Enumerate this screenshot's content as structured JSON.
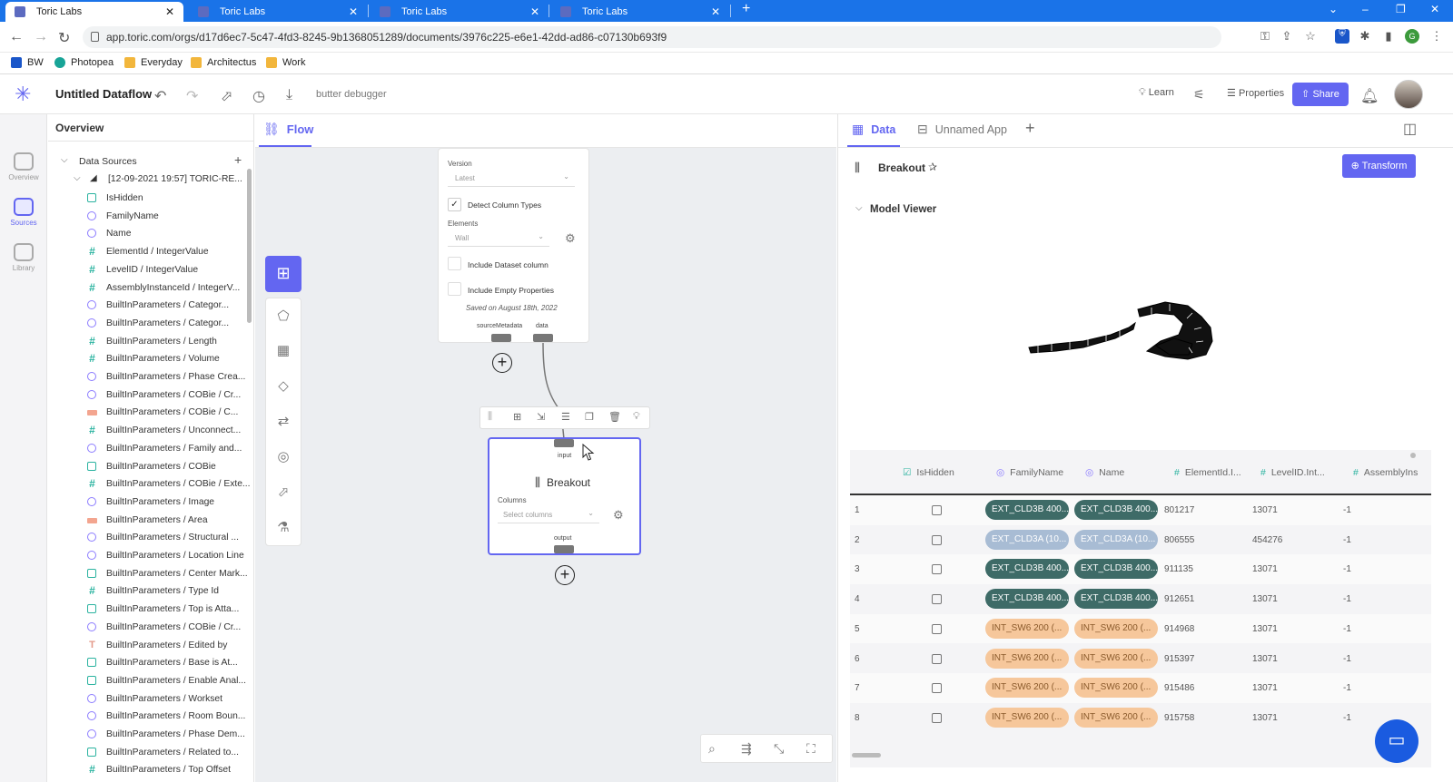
{
  "browser": {
    "tabs": [
      {
        "title": "Toric Labs"
      },
      {
        "title": "Toric Labs"
      },
      {
        "title": "Toric Labs"
      },
      {
        "title": "Toric Labs"
      }
    ],
    "url": "app.toric.com/orgs/d17d6ec7-5c47-4fd3-8245-9b1368051289/documents/3976c225-e6e1-42dd-ad86-c07130b693f9",
    "bookmarks": [
      "BW",
      "Photopea",
      "Everyday",
      "Architectus",
      "Work"
    ]
  },
  "app": {
    "title": "Untitled Dataflow",
    "debugger_label": "butter debugger",
    "learn_label": "Learn",
    "properties_label": "Properties",
    "share_label": "Share"
  },
  "rail": [
    {
      "label": "Overview",
      "icon": "overview-icon"
    },
    {
      "label": "Sources",
      "icon": "database-icon"
    },
    {
      "label": "Library",
      "icon": "library-icon"
    }
  ],
  "sidebar": {
    "title": "Overview",
    "section": "Data Sources",
    "source": "[12-09-2021 19:57] TORIC-RE...",
    "fields": [
      {
        "type": "bool",
        "label": "IsHidden"
      },
      {
        "type": "str",
        "label": "FamilyName"
      },
      {
        "type": "str",
        "label": "Name"
      },
      {
        "type": "num",
        "label": "ElementId / IntegerValue"
      },
      {
        "type": "num",
        "label": "LevelID / IntegerValue"
      },
      {
        "type": "num",
        "label": "AssemblyInstanceId / IntegerV..."
      },
      {
        "type": "str",
        "label": "BuiltInParameters / Categor..."
      },
      {
        "type": "str",
        "label": "BuiltInParameters / Categor..."
      },
      {
        "type": "num",
        "label": "BuiltInParameters / Length"
      },
      {
        "type": "num",
        "label": "BuiltInParameters / Volume"
      },
      {
        "type": "str",
        "label": "BuiltInParameters / Phase Crea..."
      },
      {
        "type": "str",
        "label": "BuiltInParameters / COBie / Cr..."
      },
      {
        "type": "obj",
        "label": "BuiltInParameters / COBie / C..."
      },
      {
        "type": "num",
        "label": "BuiltInParameters / Unconnect..."
      },
      {
        "type": "str",
        "label": "BuiltInParameters / Family and..."
      },
      {
        "type": "bool",
        "label": "BuiltInParameters / COBie"
      },
      {
        "type": "num",
        "label": "BuiltInParameters / COBie / Exte..."
      },
      {
        "type": "str",
        "label": "BuiltInParameters / Image"
      },
      {
        "type": "obj",
        "label": "BuiltInParameters / Area"
      },
      {
        "type": "str",
        "label": "BuiltInParameters / Structural ..."
      },
      {
        "type": "str",
        "label": "BuiltInParameters / Location Line"
      },
      {
        "type": "bool",
        "label": "BuiltInParameters / Center Mark..."
      },
      {
        "type": "num",
        "label": "BuiltInParameters / Type Id"
      },
      {
        "type": "bool",
        "label": "BuiltInParameters / Top is Atta..."
      },
      {
        "type": "str",
        "label": "BuiltInParameters / COBie / Cr..."
      },
      {
        "type": "txt",
        "label": "BuiltInParameters / Edited by"
      },
      {
        "type": "bool",
        "label": "BuiltInParameters / Base is At..."
      },
      {
        "type": "bool",
        "label": "BuiltInParameters / Enable Anal..."
      },
      {
        "type": "str",
        "label": "BuiltInParameters / Workset"
      },
      {
        "type": "str",
        "label": "BuiltInParameters / Room Boun..."
      },
      {
        "type": "str",
        "label": "BuiltInParameters / Phase Dem..."
      },
      {
        "type": "bool",
        "label": "BuiltInParameters / Related to..."
      },
      {
        "type": "num",
        "label": "BuiltInParameters / Top Offset"
      }
    ]
  },
  "flow": {
    "tab_label": "Flow",
    "source_node": {
      "version_label": "Version",
      "version_value": "Latest",
      "detect_label": "Detect Column Types",
      "elements_label": "Elements",
      "elements_value": "Wall",
      "include_dataset": "Include Dataset column",
      "include_empty": "Include Empty Properties",
      "saved": "Saved on August 18th, 2022",
      "port_meta": "sourceMetadata",
      "port_data": "data"
    },
    "breakout_node": {
      "input_label": "input",
      "title": "Breakout",
      "columns_label": "Columns",
      "columns_placeholder": "Select columns",
      "output_label": "output"
    }
  },
  "data_panel": {
    "tabs": [
      {
        "label": "Data"
      },
      {
        "label": "Unnamed App"
      }
    ],
    "node_title": "Breakout",
    "transform_label": "Transform",
    "viewer_label": "Model Viewer",
    "columns": [
      {
        "icon": "checkbox-icon",
        "label": "IsHidden"
      },
      {
        "icon": "string-icon",
        "label": "FamilyName"
      },
      {
        "icon": "string-icon",
        "label": "Name"
      },
      {
        "icon": "hash-icon",
        "label": "ElementId.I..."
      },
      {
        "icon": "hash-icon",
        "label": "LevelID.Int..."
      },
      {
        "icon": "hash-icon",
        "label": "AssemblyIns"
      }
    ],
    "rows": [
      {
        "n": "1",
        "family": "EXT_CLD3B 400...",
        "name": "EXT_CLD3B 400...",
        "style": "dark",
        "elementId": "801217",
        "levelId": "13071",
        "assembly": "-1"
      },
      {
        "n": "2",
        "family": "EXT_CLD3A (10...",
        "name": "EXT_CLD3A (10...",
        "style": "light",
        "elementId": "806555",
        "levelId": "454276",
        "assembly": "-1"
      },
      {
        "n": "3",
        "family": "EXT_CLD3B 400...",
        "name": "EXT_CLD3B 400...",
        "style": "dark",
        "elementId": "911135",
        "levelId": "13071",
        "assembly": "-1"
      },
      {
        "n": "4",
        "family": "EXT_CLD3B 400...",
        "name": "EXT_CLD3B 400...",
        "style": "dark",
        "elementId": "912651",
        "levelId": "13071",
        "assembly": "-1"
      },
      {
        "n": "5",
        "family": "INT_SW6 200 (...",
        "name": "INT_SW6 200 (...",
        "style": "orange",
        "elementId": "914968",
        "levelId": "13071",
        "assembly": "-1"
      },
      {
        "n": "6",
        "family": "INT_SW6 200 (...",
        "name": "INT_SW6 200 (...",
        "style": "orange",
        "elementId": "915397",
        "levelId": "13071",
        "assembly": "-1"
      },
      {
        "n": "7",
        "family": "INT_SW6 200 (...",
        "name": "INT_SW6 200 (...",
        "style": "orange",
        "elementId": "915486",
        "levelId": "13071",
        "assembly": "-1"
      },
      {
        "n": "8",
        "family": "INT_SW6 200 (...",
        "name": "INT_SW6 200 (...",
        "style": "orange",
        "elementId": "915758",
        "levelId": "13071",
        "assembly": "-1"
      }
    ]
  },
  "colors": {
    "accent": "#6366f1",
    "browser_bar": "#1a73e8",
    "pill_dark": "#3e6b67",
    "pill_light": "#a8bcd4",
    "pill_orange": "#f6c79b"
  }
}
